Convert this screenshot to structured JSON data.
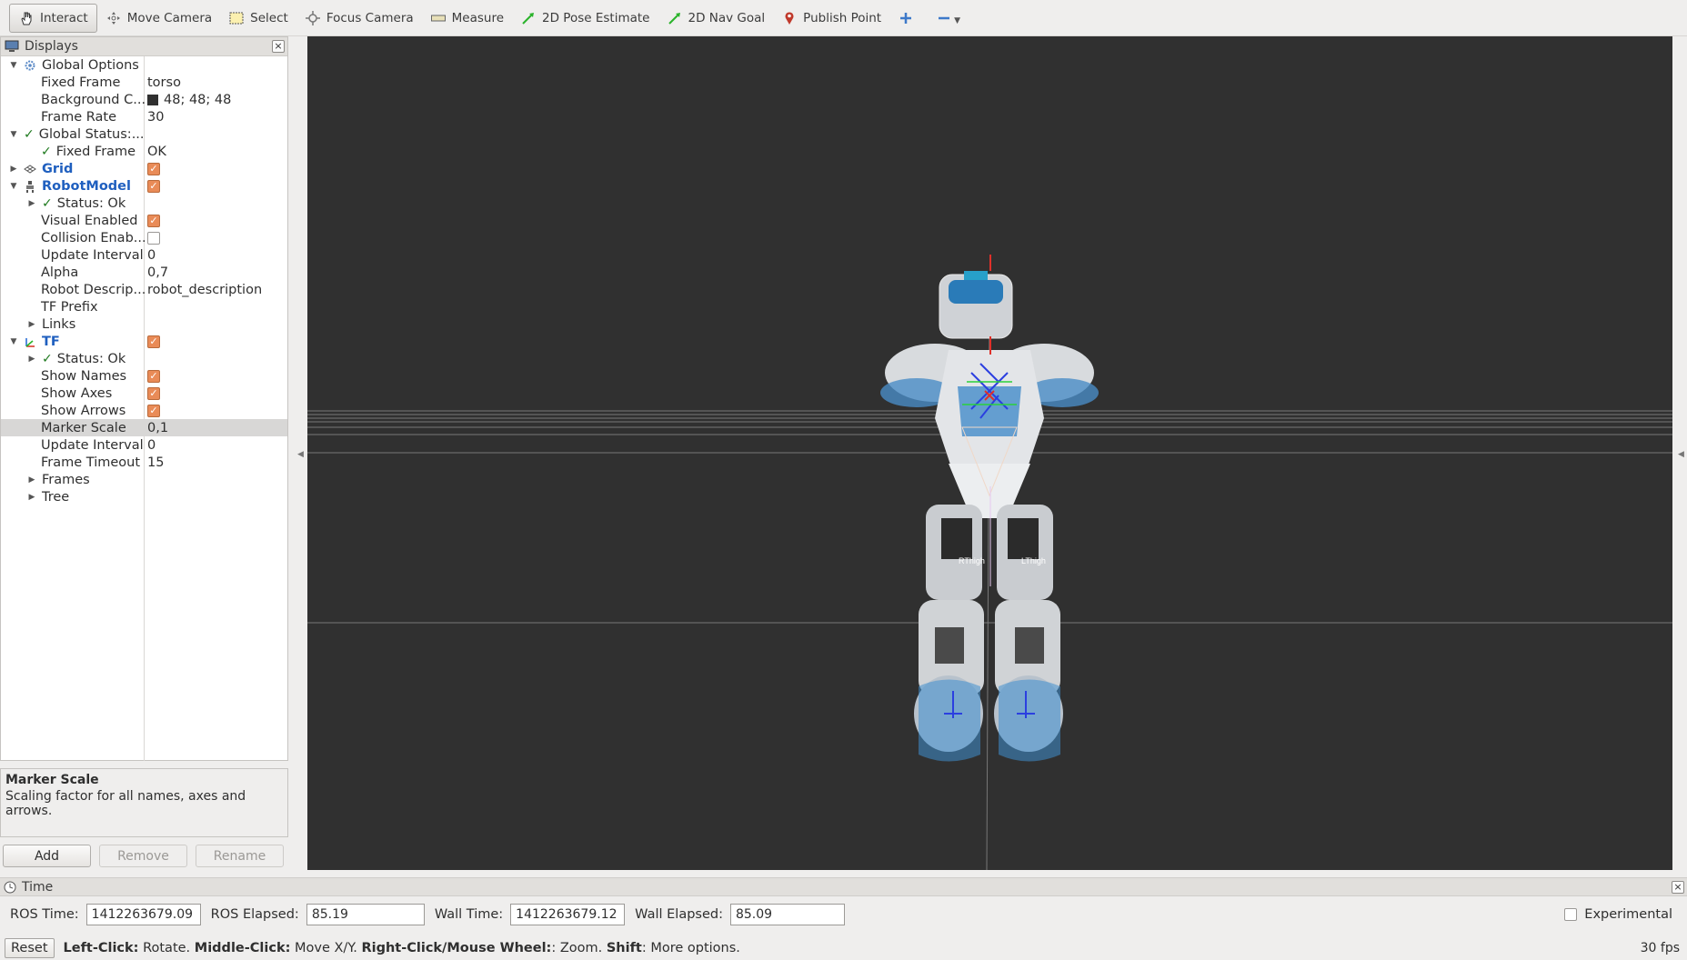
{
  "toolbar": {
    "tools": [
      {
        "label": "Interact",
        "icon": "hand-icon",
        "active": true
      },
      {
        "label": "Move Camera",
        "icon": "move-camera-icon"
      },
      {
        "label": "Select",
        "icon": "select-box-icon"
      },
      {
        "label": "Focus Camera",
        "icon": "focus-icon"
      },
      {
        "label": "Measure",
        "icon": "ruler-icon"
      },
      {
        "label": "2D Pose Estimate",
        "icon": "green-arrow-icon"
      },
      {
        "label": "2D Nav Goal",
        "icon": "green-arrow-icon"
      },
      {
        "label": "Publish Point",
        "icon": "pin-icon"
      }
    ]
  },
  "displays": {
    "title": "Displays",
    "rows": [
      {
        "name": "Global Options",
        "value": ""
      },
      {
        "name": "Fixed Frame",
        "value": "torso"
      },
      {
        "name": "Background C...",
        "value": "48; 48; 48"
      },
      {
        "name": "Frame Rate",
        "value": "30"
      },
      {
        "name": "Global Status:...",
        "value": ""
      },
      {
        "name": "Fixed Frame",
        "value": "OK"
      },
      {
        "name": "Grid",
        "value": ""
      },
      {
        "name": "RobotModel",
        "value": ""
      },
      {
        "name": "Status: Ok",
        "value": ""
      },
      {
        "name": "Visual Enabled",
        "value": ""
      },
      {
        "name": "Collision Enab...",
        "value": ""
      },
      {
        "name": "Update Interval",
        "value": "0"
      },
      {
        "name": "Alpha",
        "value": "0,7"
      },
      {
        "name": "Robot Descrip...",
        "value": "robot_description"
      },
      {
        "name": "TF Prefix",
        "value": ""
      },
      {
        "name": "Links",
        "value": ""
      },
      {
        "name": "TF",
        "value": ""
      },
      {
        "name": "Status: Ok",
        "value": ""
      },
      {
        "name": "Show Names",
        "value": ""
      },
      {
        "name": "Show Axes",
        "value": ""
      },
      {
        "name": "Show Arrows",
        "value": ""
      },
      {
        "name": "Marker Scale",
        "value": "0,1"
      },
      {
        "name": "Update Interval",
        "value": "0"
      },
      {
        "name": "Frame Timeout",
        "value": "15"
      },
      {
        "name": "Frames",
        "value": ""
      },
      {
        "name": "Tree",
        "value": ""
      }
    ],
    "help_title": "Marker Scale",
    "help_text": "Scaling factor for all names, axes and arrows.",
    "buttons": {
      "add": "Add",
      "remove": "Remove",
      "rename": "Rename"
    }
  },
  "time": {
    "title": "Time",
    "ros_time_label": "ROS Time:",
    "ros_time": "1412263679.09",
    "ros_elapsed_label": "ROS Elapsed:",
    "ros_elapsed": "85.19",
    "wall_time_label": "Wall Time:",
    "wall_time": "1412263679.12",
    "wall_elapsed_label": "Wall Elapsed:",
    "wall_elapsed": "85.09",
    "experimental_label": "Experimental"
  },
  "status": {
    "reset": "Reset",
    "left_click": "Left-Click:",
    "left_click_desc": " Rotate. ",
    "middle_click": "Middle-Click:",
    "middle_click_desc": " Move X/Y. ",
    "right_click": "Right-Click/Mouse Wheel:",
    "right_click_desc": ": Zoom. ",
    "shift": "Shift",
    "shift_desc": ": More options.",
    "fps": "30 fps"
  },
  "view": {
    "background": "#303030",
    "robot_labels": {
      "rthigh": "RThigh",
      "lthigh": "LThigh"
    }
  }
}
